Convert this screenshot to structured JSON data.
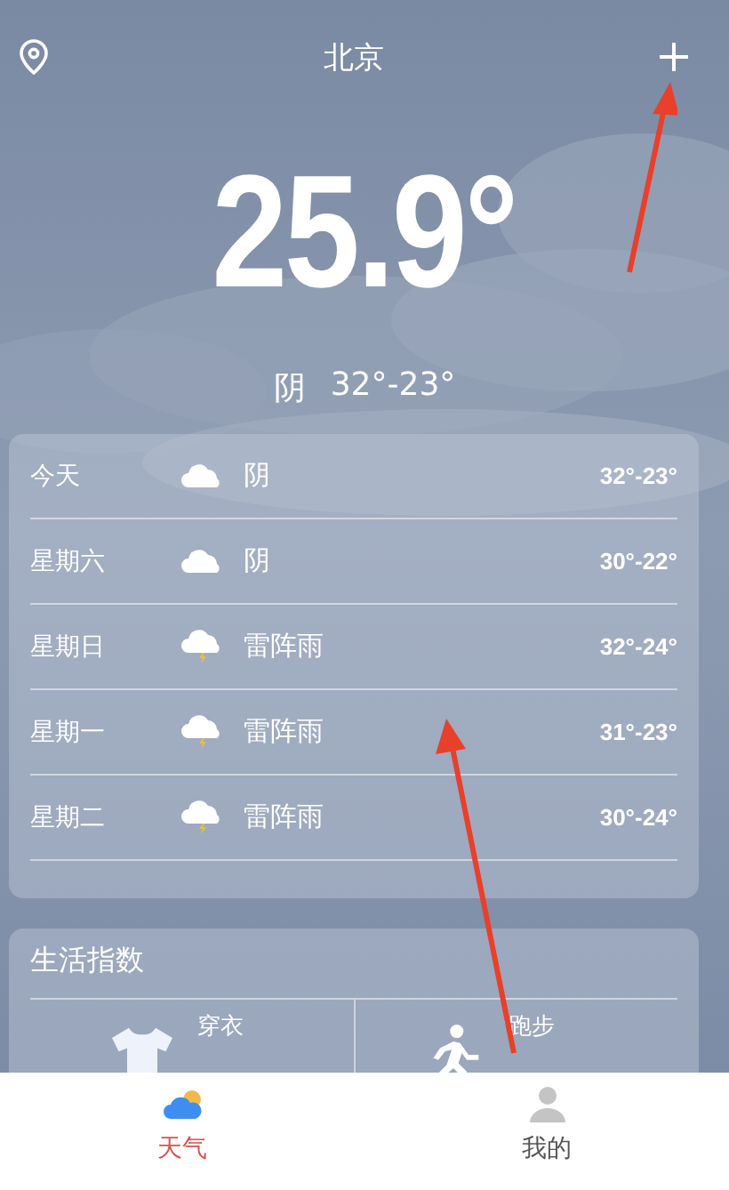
{
  "header": {
    "city": "北京"
  },
  "current": {
    "temperature": "25.9°",
    "condition": "阴",
    "range": "32°-23°"
  },
  "forecast": [
    {
      "day": "今天",
      "kind": "cloudy",
      "condition": "阴",
      "range": "32°-23°"
    },
    {
      "day": "星期六",
      "kind": "cloudy",
      "condition": "阴",
      "range": "30°-22°"
    },
    {
      "day": "星期日",
      "kind": "thunder",
      "condition": "雷阵雨",
      "range": "32°-24°"
    },
    {
      "day": "星期一",
      "kind": "thunder",
      "condition": "雷阵雨",
      "range": "31°-23°"
    },
    {
      "day": "星期二",
      "kind": "thunder",
      "condition": "雷阵雨",
      "range": "30°-24°"
    }
  ],
  "life_index": {
    "title": "生活指数",
    "items": [
      {
        "kind": "clothing",
        "label": "穿衣"
      },
      {
        "kind": "running",
        "label": "跑步"
      }
    ]
  },
  "tab_bar": [
    {
      "kind": "weather",
      "label": "天气",
      "selected": true
    },
    {
      "kind": "profile",
      "label": "我的",
      "selected": false
    }
  ]
}
